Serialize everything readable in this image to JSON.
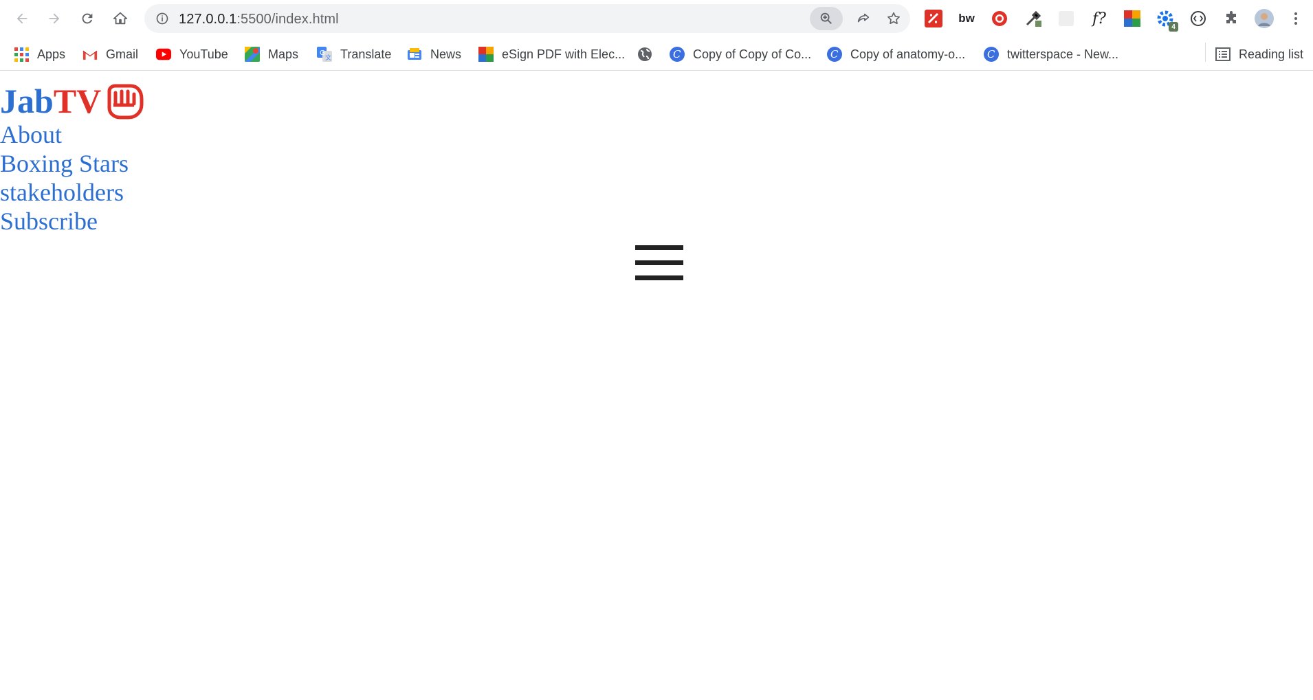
{
  "browser": {
    "url_host": "127.0.0.1",
    "url_path": ":5500/index.html",
    "extensions": [
      {
        "name": "pdf-extension-icon",
        "label": ""
      },
      {
        "name": "bw-extension-icon",
        "label": "bw"
      },
      {
        "name": "record-extension-icon",
        "label": ""
      },
      {
        "name": "eyedropper-extension-icon",
        "label": ""
      },
      {
        "name": "blank-extension-icon",
        "label": ""
      },
      {
        "name": "fonts-extension-icon",
        "label": "f?"
      },
      {
        "name": "colorgrid-extension-icon",
        "label": ""
      },
      {
        "name": "gear-extension-icon",
        "label": "",
        "badge": "4"
      },
      {
        "name": "code-extension-icon",
        "label": ""
      }
    ]
  },
  "bookmarks": {
    "items": [
      {
        "label": "Apps",
        "icon": "apps-grid-icon"
      },
      {
        "label": "Gmail",
        "icon": "gmail-icon"
      },
      {
        "label": "YouTube",
        "icon": "youtube-icon"
      },
      {
        "label": "Maps",
        "icon": "maps-icon"
      },
      {
        "label": "Translate",
        "icon": "translate-icon"
      },
      {
        "label": "News",
        "icon": "news-icon"
      },
      {
        "label": "eSign PDF with Elec...",
        "icon": "esign-icon"
      },
      {
        "label": "",
        "icon": "globe-icon"
      },
      {
        "label": "Copy of Copy of Co...",
        "icon": "canva-icon"
      },
      {
        "label": "Copy of anatomy-o...",
        "icon": "canva-icon"
      },
      {
        "label": "twitterspace - New...",
        "icon": "canva-icon"
      }
    ],
    "reading_list": "Reading list"
  },
  "page": {
    "logo_jab": "Jab",
    "logo_tv": "TV",
    "menu": [
      "About",
      "Boxing Stars",
      "stakeholders",
      "Subscribe"
    ]
  },
  "colors": {
    "brand_blue": "#2c6fd1",
    "brand_red": "#e03128",
    "hamburger": "#222222"
  }
}
